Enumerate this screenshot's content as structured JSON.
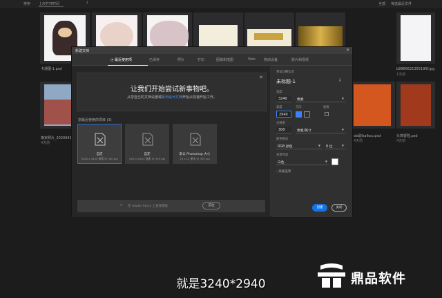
{
  "topbar": {
    "sort_label": "排序",
    "sort_value": "上次打开时间",
    "arrow": "↓",
    "right1": "全部",
    "right2": "筛选最近文件"
  },
  "thumbs_row1": [
    {
      "name": "卡通图-1.psd",
      "sub": ""
    },
    {
      "name": "",
      "sub": ""
    },
    {
      "name": "",
      "sub": ""
    },
    {
      "name": "",
      "sub": ""
    },
    {
      "name": "",
      "sub": ""
    },
    {
      "name": "",
      "sub": ""
    },
    {
      "name": "b8966621355190f.jpg",
      "sub": "1天前"
    }
  ],
  "thumbs_row2": [
    {
      "name": "南京照片_2020942",
      "sub": "4天前"
    },
    {
      "name": "",
      "sub": ""
    },
    {
      "name": "",
      "sub": ""
    },
    {
      "name": "",
      "sub": ""
    },
    {
      "name": "",
      "sub": ""
    },
    {
      "name": "ob是lkaikou.psd",
      "sub": "4天前"
    },
    {
      "name": "头饰冒险.psd",
      "sub": "4天前"
    }
  ],
  "dialog": {
    "title": "新建文档",
    "close": "✕",
    "tabs": [
      "最近使用项",
      "已保存",
      "照片",
      "打印",
      "图稿和插图",
      "Web",
      "移动设备",
      "胶片和视频"
    ],
    "banner": {
      "headline": "让我们开始尝试新事物吧。",
      "text_before": "从您自己的文档设置或",
      "link": "系列设计文档",
      "text_after": "开始以快速开始工作。",
      "close": "✕"
    },
    "recent_label": "您最近使用的项目 (3)",
    "presets": [
      {
        "name": "自定",
        "desc": "3240 x 4440 像素 @ 300 ppi"
      },
      {
        "name": "自定",
        "desc": "XXX x XXXX 像素 @ 300 ppi"
      },
      {
        "name": "默认 Photoshop 大小",
        "desc": "16 x 12 厘米 @ 300 ppi"
      }
    ],
    "search": {
      "placeholder": "在 Adobe Stock 上查找模板",
      "button": "前往"
    },
    "right": {
      "section": "预设详细信息",
      "doc_name": "未标题-1",
      "width_label": "宽度",
      "width": "3240",
      "width_unit": "像素",
      "height_label": "高度",
      "height": "2940",
      "orientation_label": "方向",
      "artboard_label": "画板",
      "resolution_label": "分辨率",
      "resolution": "300",
      "resolution_unit": "像素/英寸",
      "color_mode_label": "颜色模式",
      "color_mode": "RGB 颜色",
      "bit_depth": "8 位",
      "bg_label": "背景内容",
      "bg": "白色",
      "advanced": "高级选项",
      "create": "创建",
      "close": "关闭"
    }
  },
  "subtitle": "就是3240*2940",
  "logo": {
    "text": "鼎品软件"
  },
  "colors": {
    "accent": "#1473e6",
    "bg": "#1c1c1d",
    "dialog": "#323232"
  }
}
